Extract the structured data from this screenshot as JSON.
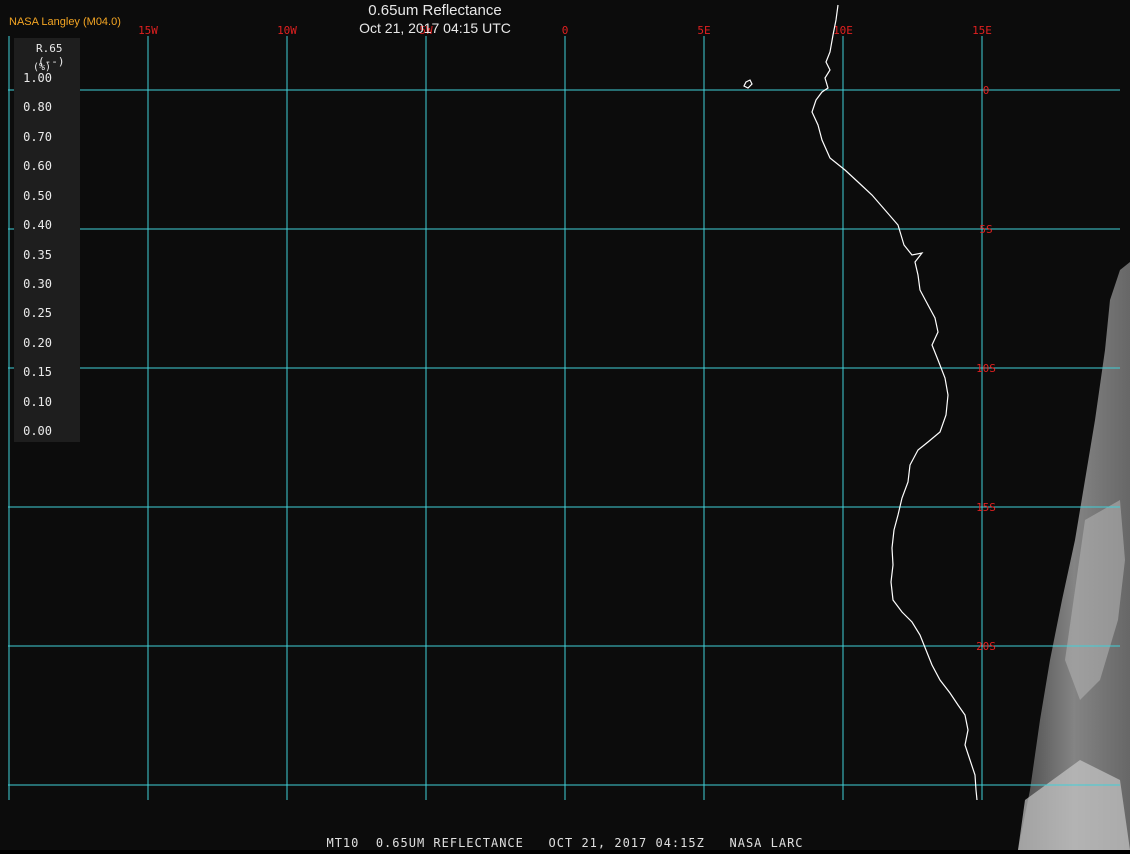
{
  "header": {
    "brand": "NASA Langley (M04.0)",
    "title": "0.65um Reflectance",
    "datetime": "Oct 21, 2017 04:15 UTC"
  },
  "footer": {
    "caption": "MT10  0.65UM REFLECTANCE   OCT 21, 2017 04:15Z   NASA LARC"
  },
  "legend": {
    "variable": "R.65",
    "units": "(--)",
    "extra": "(%)",
    "labels": [
      "1.00",
      "0.80",
      "0.70",
      "0.60",
      "0.50",
      "0.40",
      "0.35",
      "0.30",
      "0.25",
      "0.20",
      "0.15",
      "0.10",
      "0.00"
    ]
  },
  "grid": {
    "longitudes": [
      "15W",
      "10W",
      "5W",
      "0",
      "5E",
      "10E",
      "15E"
    ],
    "latitudes": [
      "0",
      "5S",
      "10S",
      "15S",
      "20S"
    ]
  },
  "colors": {
    "background": "#0c0c0c",
    "gridline": "#40d0d8",
    "grid_label": "#e02020",
    "coastline": "#ffffff",
    "brand": "#f5a623"
  }
}
